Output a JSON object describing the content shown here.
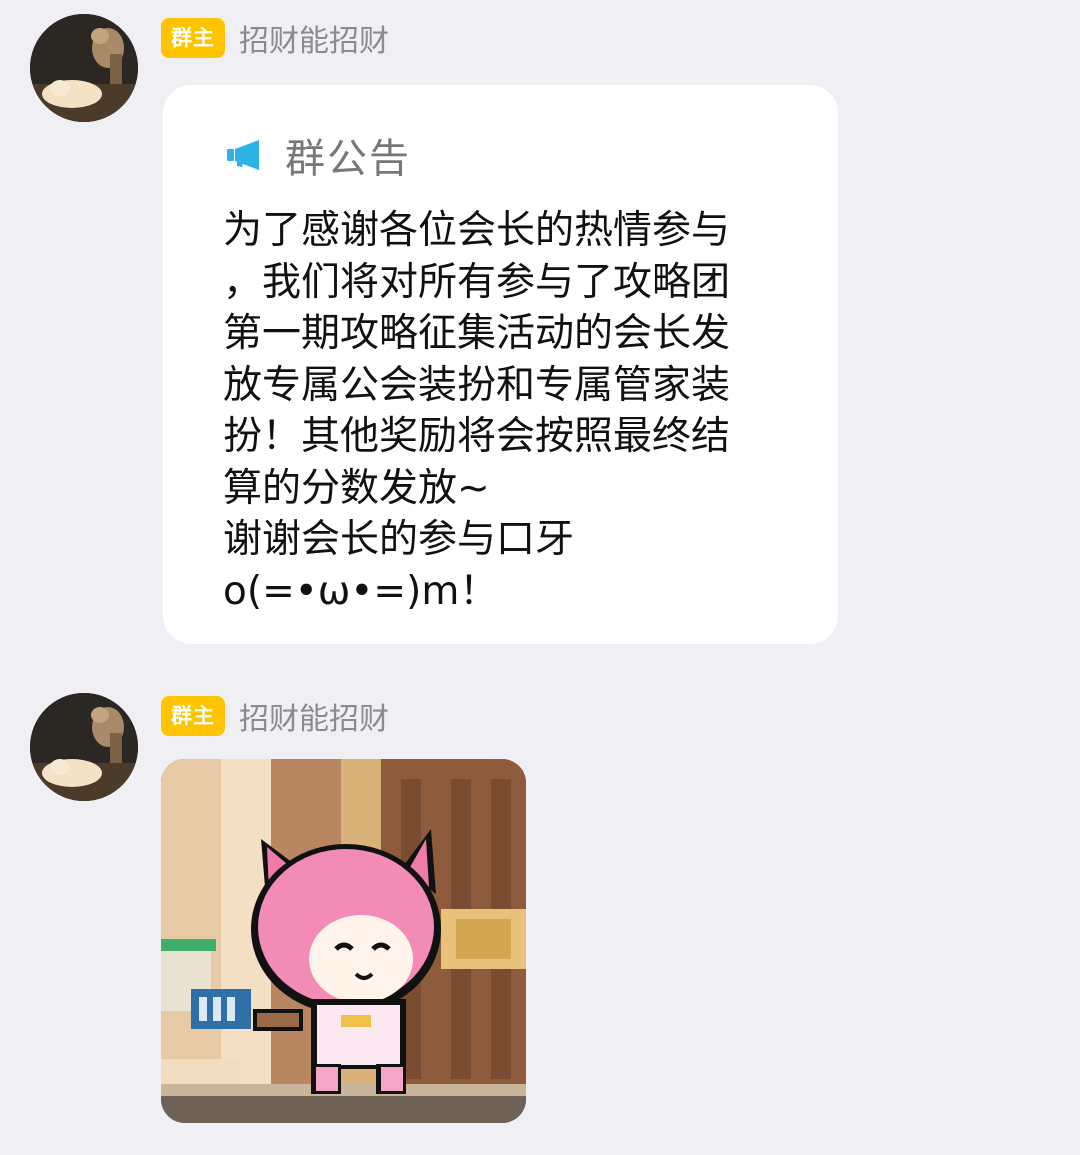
{
  "messages": [
    {
      "badge": "群主",
      "nickname": "招财能招财",
      "announcement": {
        "icon": "megaphone-icon",
        "title": "群公告",
        "lines": [
          "为了感谢各位会长的热情参与",
          "，我们将对所有参与了攻略团",
          "第一期攻略征集活动的会长发",
          "放专属公会装扮和专属管家装",
          "扮！其他奖励将会按照最终结",
          "算的分数发放~",
          "谢谢会长的参与口牙",
          "o(=•ω•=)m！"
        ]
      }
    },
    {
      "badge": "群主",
      "nickname": "招财能招财"
    }
  ],
  "colors": {
    "background": "#efeff4",
    "badge": "#ffc400",
    "accent": "#2bb3e6"
  }
}
